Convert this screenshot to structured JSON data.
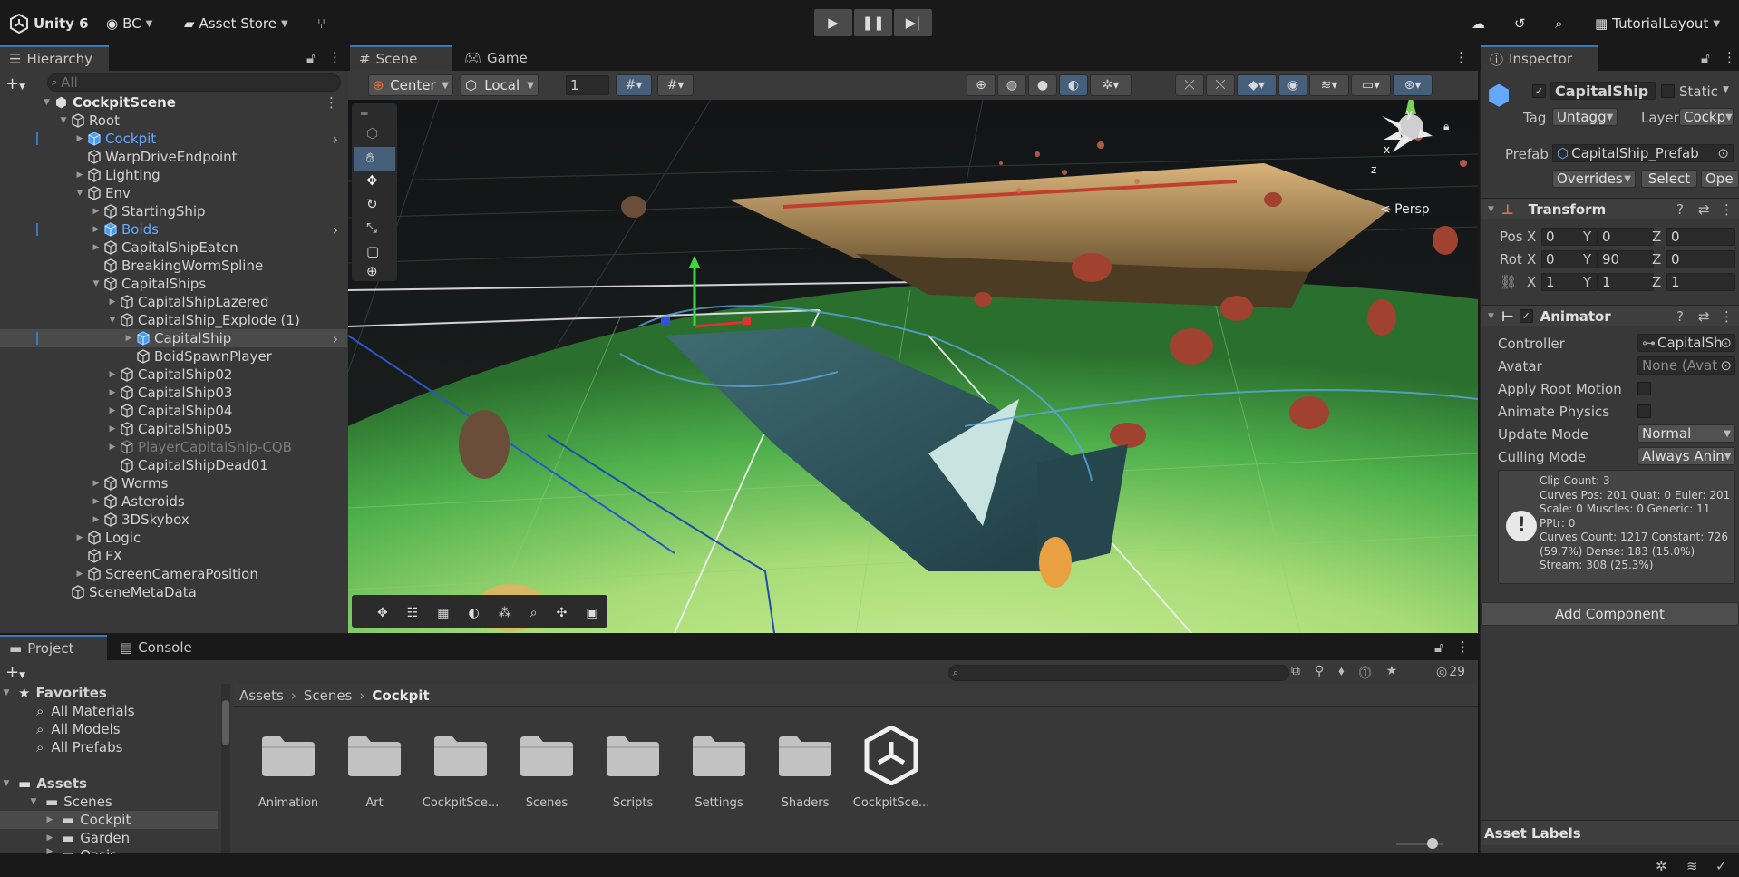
{
  "topbar": {
    "app_name": "Unity 6",
    "account": "BC",
    "asset_store": "Asset Store",
    "layout": "TutorialLayout"
  },
  "hierarchy": {
    "tab": "Hierarchy",
    "search_placeholder": "All",
    "scene": "CockpitScene",
    "items": [
      {
        "label": "Root",
        "depth": 0,
        "arrow": "down",
        "style": "normal"
      },
      {
        "label": "Cockpit",
        "depth": 1,
        "arrow": "right",
        "style": "blue"
      },
      {
        "label": "WarpDriveEndpoint",
        "depth": 1,
        "arrow": "",
        "style": "normal"
      },
      {
        "label": "Lighting",
        "depth": 1,
        "arrow": "right",
        "style": "normal"
      },
      {
        "label": "Env",
        "depth": 1,
        "arrow": "down",
        "style": "normal"
      },
      {
        "label": "StartingShip",
        "depth": 2,
        "arrow": "right",
        "style": "normal"
      },
      {
        "label": "Boids",
        "depth": 2,
        "arrow": "right",
        "style": "blue"
      },
      {
        "label": "CapitalShipEaten",
        "depth": 2,
        "arrow": "right",
        "style": "normal"
      },
      {
        "label": "BreakingWormSpline",
        "depth": 2,
        "arrow": "",
        "style": "normal"
      },
      {
        "label": "CapitalShips",
        "depth": 2,
        "arrow": "down",
        "style": "normal"
      },
      {
        "label": "CapitalShipLazered",
        "depth": 3,
        "arrow": "right",
        "style": "normal"
      },
      {
        "label": "CapitalShip_Explode (1)",
        "depth": 3,
        "arrow": "down",
        "style": "normal"
      },
      {
        "label": "CapitalShip",
        "depth": 4,
        "arrow": "right",
        "style": "selected"
      },
      {
        "label": "BoidSpawnPlayer",
        "depth": 4,
        "arrow": "",
        "style": "normal"
      },
      {
        "label": "CapitalShip02",
        "depth": 3,
        "arrow": "right",
        "style": "normal"
      },
      {
        "label": "CapitalShip03",
        "depth": 3,
        "arrow": "right",
        "style": "normal"
      },
      {
        "label": "CapitalShip04",
        "depth": 3,
        "arrow": "right",
        "style": "normal"
      },
      {
        "label": "CapitalShip05",
        "depth": 3,
        "arrow": "right",
        "style": "normal"
      },
      {
        "label": "PlayerCapitalShip-CQB",
        "depth": 3,
        "arrow": "right",
        "style": "dim"
      },
      {
        "label": "CapitalShipDead01",
        "depth": 3,
        "arrow": "",
        "style": "normal"
      },
      {
        "label": "Worms",
        "depth": 2,
        "arrow": "right",
        "style": "normal"
      },
      {
        "label": "Asteroids",
        "depth": 2,
        "arrow": "right",
        "style": "normal"
      },
      {
        "label": "3DSkybox",
        "depth": 2,
        "arrow": "right",
        "style": "normal"
      },
      {
        "label": "Logic",
        "depth": 1,
        "arrow": "right",
        "style": "normal"
      },
      {
        "label": "FX",
        "depth": 1,
        "arrow": "",
        "style": "normal"
      },
      {
        "label": "ScreenCameraPosition",
        "depth": 1,
        "arrow": "right",
        "style": "normal"
      },
      {
        "label": "SceneMetaData",
        "depth": 0,
        "arrow": "",
        "style": "normal"
      }
    ]
  },
  "scene_view": {
    "tabs": [
      "Scene",
      "Game"
    ],
    "pivot": "Center",
    "space": "Local",
    "grid_value": "1",
    "persp_label": "< Persp",
    "gizmo_axes": {
      "x": "x",
      "y": "y",
      "z": "z"
    }
  },
  "inspector": {
    "tab": "Inspector",
    "object_name": "CapitalShip",
    "static_label": "Static",
    "tag_label": "Tag",
    "tag_value": "Untagg",
    "layer_label": "Layer",
    "layer_value": "Cockp",
    "prefab_label": "Prefab",
    "prefab_value": "CapitalShip_Prefab",
    "overrides": "Overrides",
    "select": "Select",
    "open": "Ope",
    "transform": {
      "title": "Transform",
      "pos_label": "Pos",
      "rot_label": "Rot",
      "x": "X",
      "y": "Y",
      "z": "Z",
      "pos": [
        "0",
        "0",
        "0"
      ],
      "rot": [
        "0",
        "90",
        "0"
      ],
      "scale": [
        "1",
        "1",
        "1"
      ]
    },
    "animator": {
      "title": "Animator",
      "controller_label": "Controller",
      "controller_value": "CapitalSh",
      "avatar_label": "Avatar",
      "avatar_value": "None (Avat",
      "root_motion_label": "Apply Root Motion",
      "physics_label": "Animate Physics",
      "update_label": "Update Mode",
      "update_value": "Normal",
      "culling_label": "Culling Mode",
      "culling_value": "Always Anin",
      "info_lines": [
        "Clip Count: 3",
        "Curves Pos: 201 Quat: 0 Euler: 201",
        "Scale: 0 Muscles: 0 Generic: 11",
        "PPtr: 0",
        "Curves Count: 1217 Constant: 726",
        "(59.7%) Dense: 183 (15.0%)",
        "Stream: 308 (25.3%)"
      ]
    },
    "add_component": "Add Component",
    "asset_labels": "Asset Labels"
  },
  "project": {
    "tabs": [
      "Project",
      "Console"
    ],
    "hidden_count": "29",
    "favorites_label": "Favorites",
    "favorites": [
      "All Materials",
      "All Models",
      "All Prefabs"
    ],
    "assets_label": "Assets",
    "tree": [
      {
        "label": "Scenes",
        "depth": 1,
        "arrow": "down"
      },
      {
        "label": "Cockpit",
        "depth": 2,
        "arrow": "right"
      },
      {
        "label": "Garden",
        "depth": 2,
        "arrow": "right"
      },
      {
        "label": "Oasis",
        "depth": 2,
        "arrow": "right"
      }
    ],
    "breadcrumb": [
      "Assets",
      "Scenes",
      "Cockpit"
    ],
    "items": [
      "Animation",
      "Art",
      "CockpitSce...",
      "Scenes",
      "Scripts",
      "Settings",
      "Shaders",
      "CockpitSce..."
    ]
  },
  "colors": {
    "accent": "#3a79bb",
    "prefab_blue": "#66a8ff",
    "panel": "#383838",
    "topbar": "#191919"
  }
}
